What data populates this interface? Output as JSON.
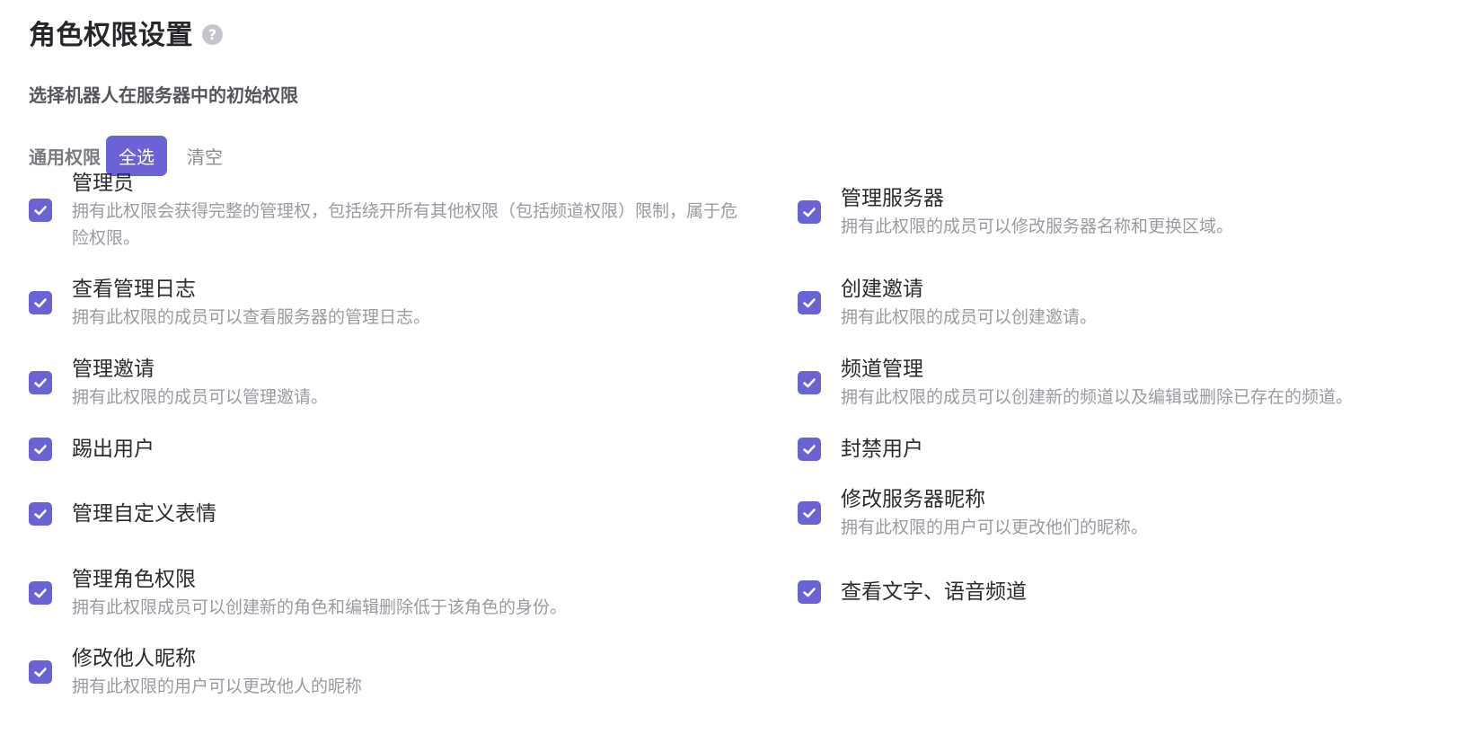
{
  "header": {
    "title": "角色权限设置",
    "help_icon": "question-circle-icon",
    "help_glyph": "?"
  },
  "subtitle": "选择机器人在服务器中的初始权限",
  "section": {
    "label": "通用权限",
    "select_all_label": "全选",
    "clear_label": "清空"
  },
  "colors": {
    "accent": "#6a63d6",
    "title": "#26272b",
    "desc": "#9a9ba2"
  },
  "permissions": [
    {
      "name": "管理员",
      "checked": true,
      "desc_line1": "拥有此权限会获得完整的管理权，包括绕开所有其他权限（包括频道权限）限制，属于危",
      "desc_line2": "险权限。"
    },
    {
      "name": "管理服务器",
      "checked": true,
      "desc": "拥有此权限的成员可以修改服务器名称和更换区域。"
    },
    {
      "name": "查看管理日志",
      "checked": true,
      "desc": "拥有此权限的成员可以查看服务器的管理日志。"
    },
    {
      "name": "创建邀请",
      "checked": true,
      "desc": "拥有此权限的成员可以创建邀请。"
    },
    {
      "name": "管理邀请",
      "checked": true,
      "desc": "拥有此权限的成员可以管理邀请。"
    },
    {
      "name": "频道管理",
      "checked": true,
      "desc": "拥有此权限的成员可以创建新的频道以及编辑或删除已存在的频道。"
    },
    {
      "name": "踢出用户",
      "checked": true
    },
    {
      "name": "封禁用户",
      "checked": true
    },
    {
      "name": "管理自定义表情",
      "checked": true
    },
    {
      "name": "修改服务器昵称",
      "checked": true,
      "desc": "拥有此权限的用户可以更改他们的昵称。"
    },
    {
      "name": "管理角色权限",
      "checked": true,
      "desc": "拥有此权限成员可以创建新的角色和编辑删除低于该角色的身份。"
    },
    {
      "name": "查看文字、语音频道",
      "checked": true
    },
    {
      "name": "修改他人昵称",
      "checked": true,
      "desc": "拥有此权限的用户可以更改他人的昵称"
    }
  ]
}
